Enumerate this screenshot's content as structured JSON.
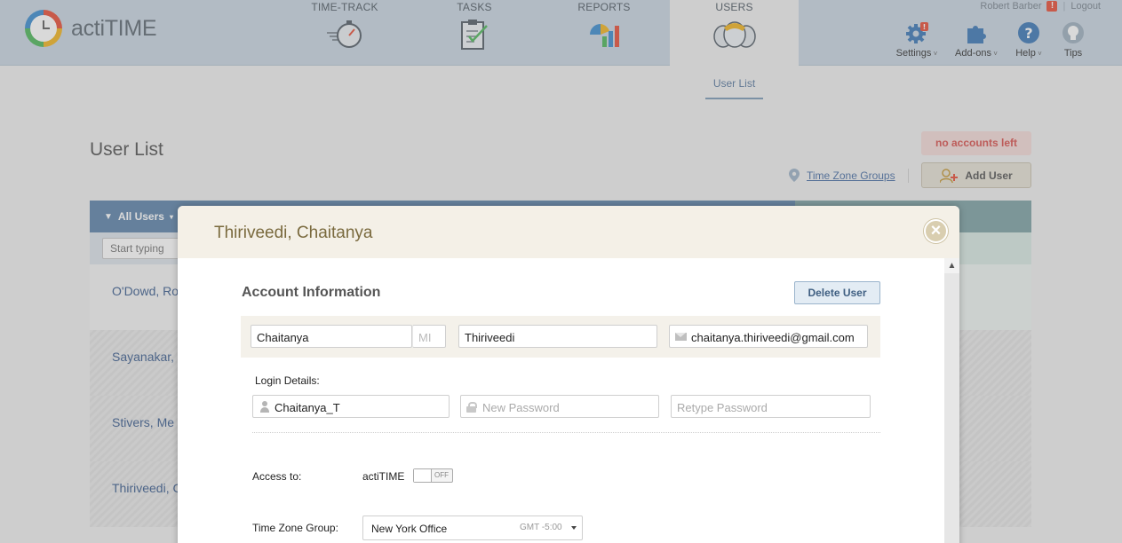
{
  "header": {
    "logo_text": "actiTIME",
    "tabs": [
      {
        "label": "TIME-TRACK",
        "icon": "stopwatch-icon"
      },
      {
        "label": "TASKS",
        "icon": "clipboard-icon"
      },
      {
        "label": "REPORTS",
        "icon": "bar-chart-icon"
      },
      {
        "label": "USERS",
        "icon": "users-icon",
        "active": true
      }
    ],
    "user_name": "Robert Barber",
    "warning_badge": "!",
    "logout": "Logout",
    "tools": [
      {
        "label": "Settings",
        "icon": "gear-icon"
      },
      {
        "label": "Add-ons",
        "icon": "puzzle-icon"
      },
      {
        "label": "Help",
        "icon": "help-icon"
      },
      {
        "label": "Tips",
        "icon": "lightbulb-icon"
      }
    ]
  },
  "subnav": {
    "active": "User List"
  },
  "page": {
    "title": "User List",
    "no_accounts": "no accounts left",
    "tz_groups_link": "Time Zone Groups",
    "add_user": "Add User",
    "filter_label": "All Users",
    "filter_placeholder": "Start typing",
    "rows": [
      "O'Dowd, Ro",
      "Sayanakar,",
      "Stivers, Me",
      "Thiriveedi, C"
    ]
  },
  "modal": {
    "title": "Thiriveedi, Chaitanya",
    "section_title": "Account Information",
    "delete_button": "Delete User",
    "first_name": "Chaitanya",
    "middle_initial_placeholder": "MI",
    "last_name": "Thiriveedi",
    "email": "chaitanya.thiriveedi@gmail.com",
    "login_label": "Login Details:",
    "username": "Chaitanya_T",
    "new_password_placeholder": "New Password",
    "retype_password_placeholder": "Retype Password",
    "access_label": "Access to:",
    "access_app": "actiTIME",
    "access_toggle": "OFF",
    "tz_group_label": "Time Zone Group:",
    "tz_group_value": "New York Office",
    "tz_group_offset": "GMT -5:00"
  },
  "colors": {
    "header_bg": "#c9d6e2",
    "list_header": "#5f84ab",
    "modal_header": "#f4f0e7",
    "warning": "#e8503a"
  }
}
